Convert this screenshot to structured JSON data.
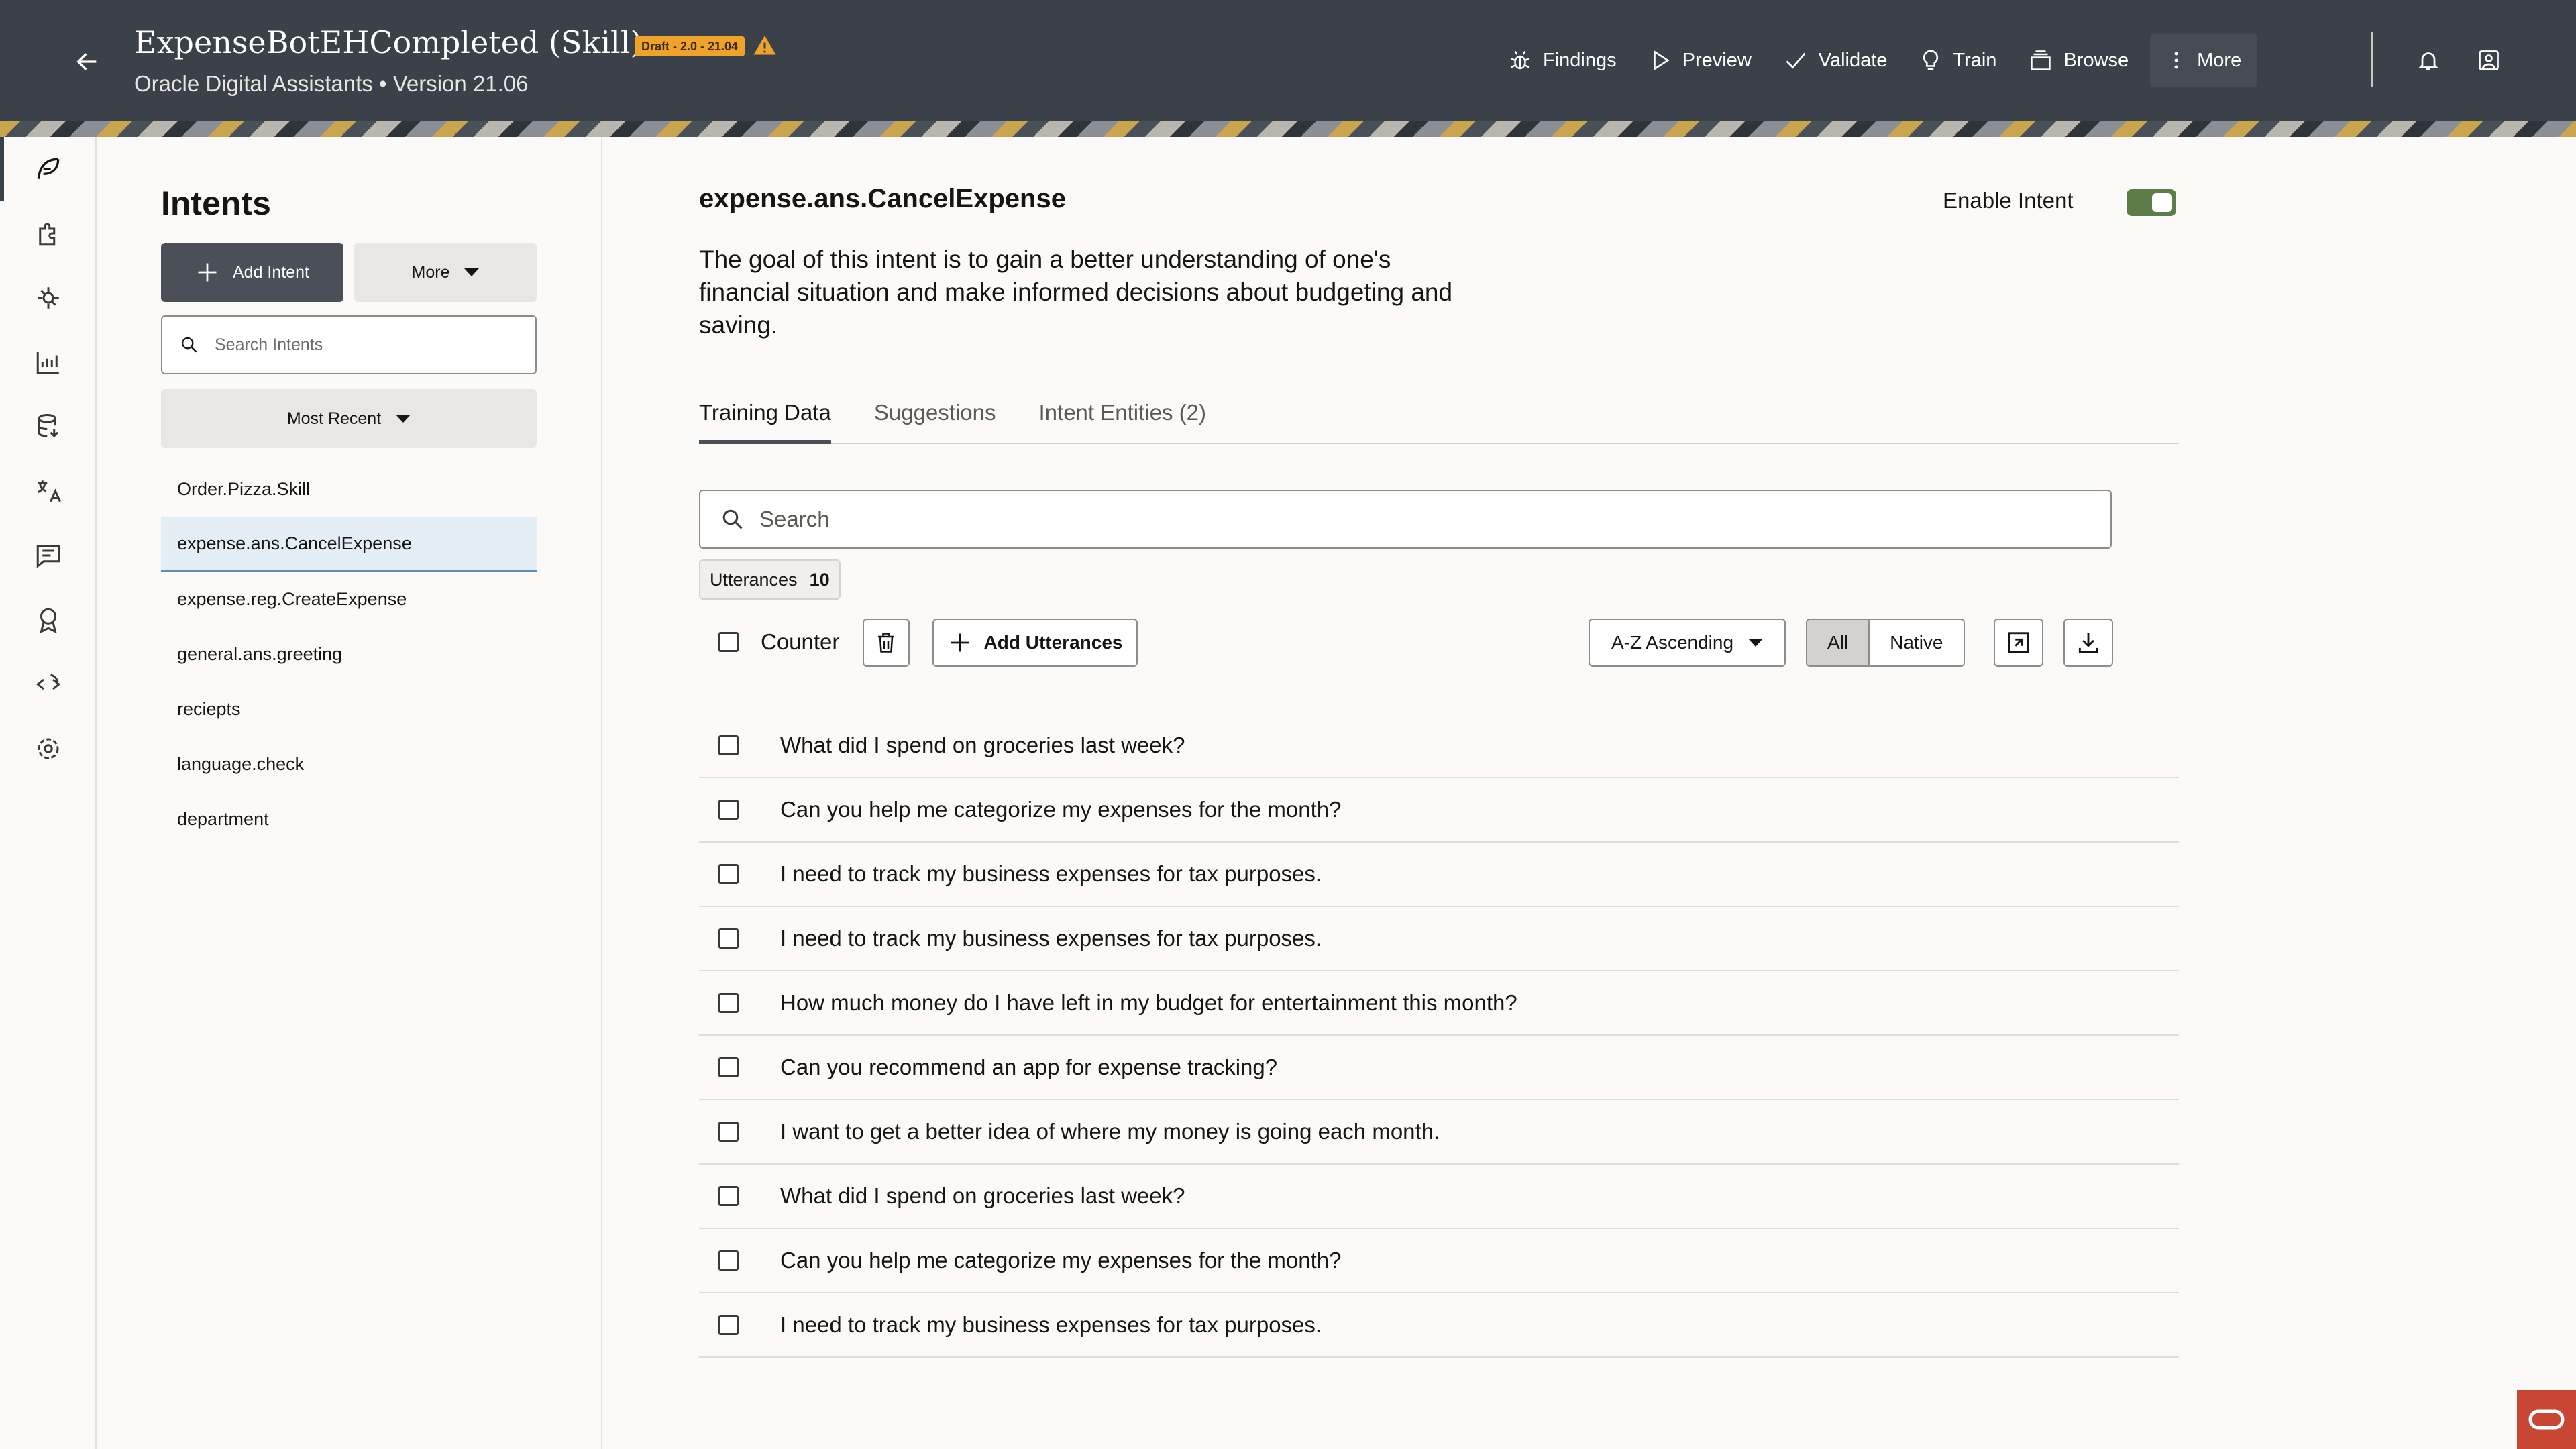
{
  "header": {
    "title": "ExpenseBotEHCompleted (Skill)",
    "badge": "Draft - 2.0 - 21.04",
    "subtitle": "Oracle Digital Assistants • Version 21.06",
    "actions": [
      {
        "label": "Findings",
        "icon": "bug-icon"
      },
      {
        "label": "Preview",
        "icon": "play-icon"
      },
      {
        "label": "Validate",
        "icon": "check-icon"
      },
      {
        "label": "Train",
        "icon": "lightbulb-icon"
      },
      {
        "label": "Browse",
        "icon": "stack-icon"
      },
      {
        "label": "More",
        "icon": "kebab-icon"
      }
    ]
  },
  "nav": {
    "items": [
      {
        "icon": "intents-feather-icon",
        "active": true
      },
      {
        "icon": "entities-puzzle-icon"
      },
      {
        "icon": "components-gear-icon"
      },
      {
        "icon": "insights-chart-icon"
      },
      {
        "icon": "data-manager-icon"
      },
      {
        "icon": "translation-icon"
      },
      {
        "icon": "conversation-icon"
      },
      {
        "icon": "quality-badge-icon"
      },
      {
        "icon": "flows-code-icon"
      },
      {
        "icon": "settings-icon"
      }
    ]
  },
  "intents_panel": {
    "title": "Intents",
    "add_label": "Add Intent",
    "more_label": "More",
    "search_placeholder": "Search Intents",
    "sort_label": "Most Recent",
    "items": [
      "Order.Pizza.Skill",
      "expense.ans.CancelExpense",
      "expense.reg.CreateExpense",
      "general.ans.greeting",
      "reciepts",
      "language.check",
      "department"
    ],
    "selected_index": 1
  },
  "main": {
    "intent_name": "expense.ans.CancelExpense",
    "enable_label": "Enable Intent",
    "enabled": true,
    "description": "The goal of this intent is to gain a better understanding of one's financial situation and make informed decisions about budgeting and saving.",
    "tabs": [
      "Training Data",
      "Suggestions",
      "Intent Entities (2)"
    ],
    "active_tab": 0,
    "search_placeholder": "Search",
    "utterances_label": "Utterances",
    "utterances_count": "10",
    "counter_label": "Counter",
    "add_utterances_label": "Add Utterances",
    "sort_value": "A-Z Ascending",
    "filter_all": "All",
    "filter_native": "Native",
    "utterances": [
      "What did I spend on groceries last week?",
      "Can you help me categorize my expenses for the month?",
      "I need to track my business expenses for tax purposes.",
      "I need to track my business expenses for tax purposes.",
      "How much money do I have left in my budget for entertainment this month?",
      "Can you recommend an app for expense tracking?",
      "I want to get a better idea of where my money is going each month.",
      "What did I spend on groceries last week?",
      "Can you help me categorize my expenses for the month?",
      "I need to track my business expenses for tax purposes."
    ]
  }
}
